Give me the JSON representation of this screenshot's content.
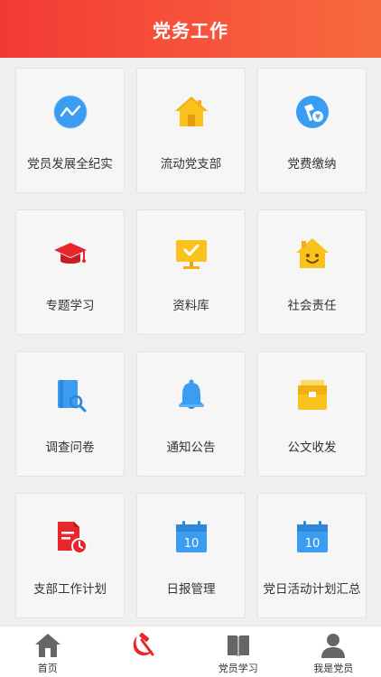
{
  "header": {
    "title": "党务工作"
  },
  "menu": [
    {
      "label": "党员发展全纪实",
      "icon": "trend-chart-icon"
    },
    {
      "label": "流动党支部",
      "icon": "house-icon"
    },
    {
      "label": "党费缴纳",
      "icon": "party-fee-icon"
    },
    {
      "label": "专题学习",
      "icon": "graduation-cap-icon"
    },
    {
      "label": "资料库",
      "icon": "monitor-check-icon"
    },
    {
      "label": "社会责任",
      "icon": "smiling-house-icon"
    },
    {
      "label": "调查问卷",
      "icon": "document-search-icon"
    },
    {
      "label": "通知公告",
      "icon": "bell-icon"
    },
    {
      "label": "公文收发",
      "icon": "briefcase-icon"
    },
    {
      "label": "支部工作计划",
      "icon": "plan-document-clock-icon"
    },
    {
      "label": "日报管理",
      "icon": "calendar-10-icon"
    },
    {
      "label": "党日活动计划汇总",
      "icon": "calendar-10-icon"
    }
  ],
  "calendar_number": "10",
  "tabs": [
    {
      "label": "首页",
      "icon": "home-icon"
    },
    {
      "label": "",
      "icon": "hammer-sickle-icon",
      "active": true
    },
    {
      "label": "党员学习",
      "icon": "book-icon"
    },
    {
      "label": "我是党员",
      "icon": "user-icon"
    }
  ],
  "colors": {
    "header_start": "#f23a35",
    "header_end": "#f76a3f",
    "blue": "#3a9af0",
    "yellow": "#f9c21c",
    "red": "#e8262b",
    "gray_icon": "#6a6a6a"
  }
}
